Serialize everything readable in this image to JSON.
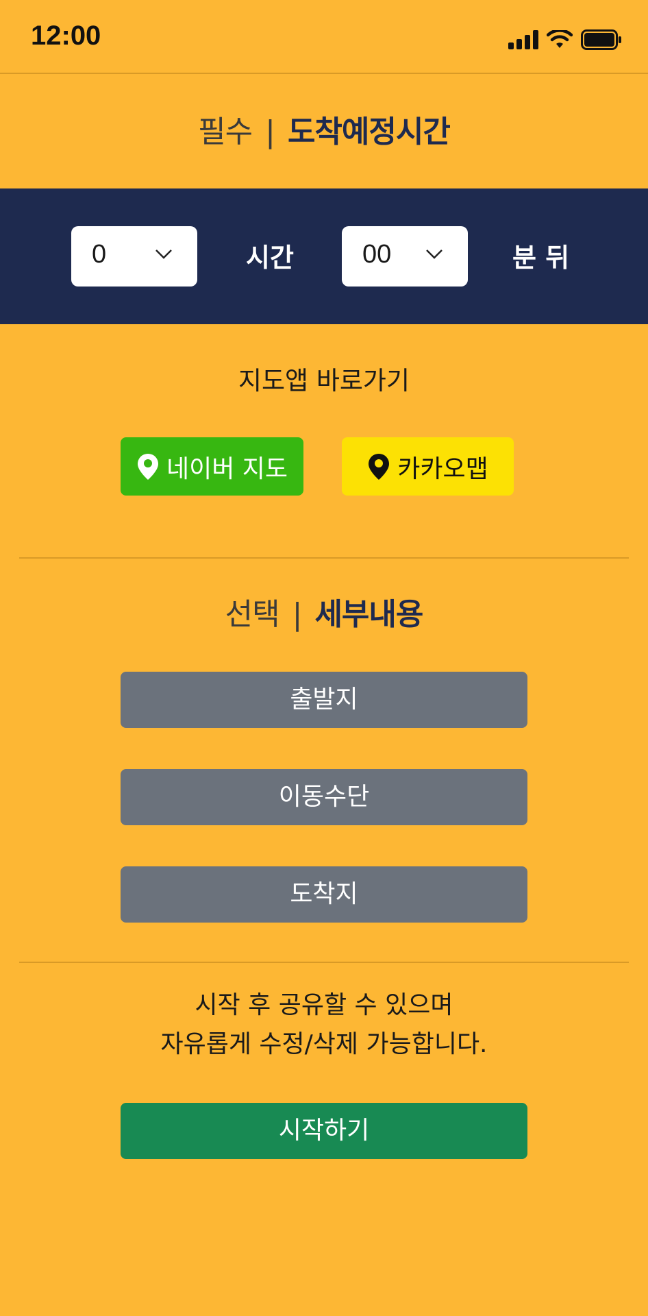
{
  "status_bar": {
    "time": "12:00"
  },
  "required_section": {
    "prefix": "필수",
    "separator": "|",
    "title": "도착예정시간"
  },
  "eta": {
    "hours": {
      "value": "0",
      "icon": "chevron-down-icon"
    },
    "hours_label": "시간",
    "minutes": {
      "value": "00",
      "icon": "chevron-down-icon"
    },
    "minutes_label": "분 뒤",
    "band_color": "#1E2A4F"
  },
  "map_shortcut": {
    "title": "지도앱 바로가기",
    "naver": {
      "label": "네이버 지도",
      "icon": "location-pin-icon",
      "color": "#37B711"
    },
    "kakao": {
      "label": "카카오맵",
      "icon": "location-pin-icon",
      "color": "#FCE104"
    }
  },
  "optional_section": {
    "prefix": "선택",
    "separator": "|",
    "title": "세부내용",
    "buttons": [
      "출발지",
      "이동수단",
      "도착지"
    ]
  },
  "notice": {
    "line1": "시작 후 공유할 수 있으며",
    "line2": "자유롭게 수정/삭제 가능합니다."
  },
  "start_button": {
    "label": "시작하기",
    "color": "#188A53"
  },
  "background_color": "#FDB734"
}
